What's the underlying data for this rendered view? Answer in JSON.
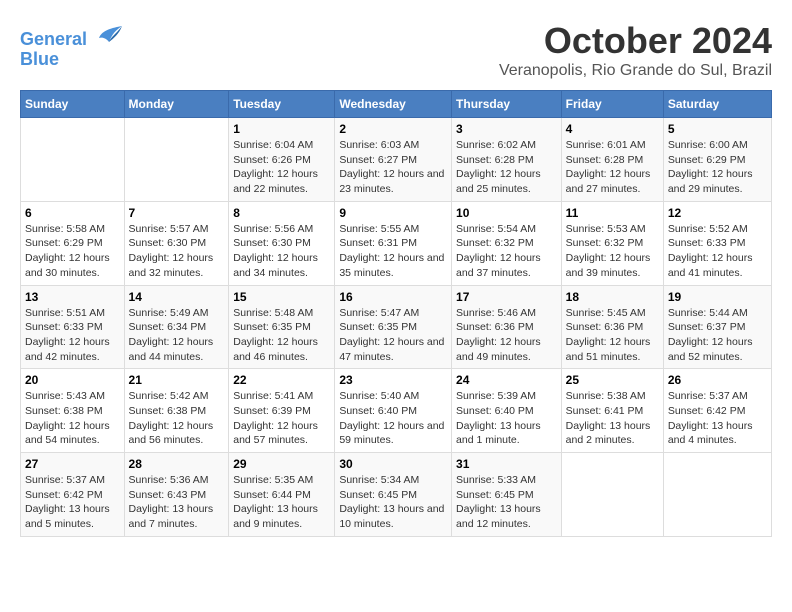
{
  "header": {
    "logo_line1": "General",
    "logo_line2": "Blue",
    "month": "October 2024",
    "location": "Veranopolis, Rio Grande do Sul, Brazil"
  },
  "weekdays": [
    "Sunday",
    "Monday",
    "Tuesday",
    "Wednesday",
    "Thursday",
    "Friday",
    "Saturday"
  ],
  "weeks": [
    [
      {
        "day": null,
        "sunrise": null,
        "sunset": null,
        "daylight": null
      },
      {
        "day": null,
        "sunrise": null,
        "sunset": null,
        "daylight": null
      },
      {
        "day": "1",
        "sunrise": "Sunrise: 6:04 AM",
        "sunset": "Sunset: 6:26 PM",
        "daylight": "Daylight: 12 hours and 22 minutes."
      },
      {
        "day": "2",
        "sunrise": "Sunrise: 6:03 AM",
        "sunset": "Sunset: 6:27 PM",
        "daylight": "Daylight: 12 hours and 23 minutes."
      },
      {
        "day": "3",
        "sunrise": "Sunrise: 6:02 AM",
        "sunset": "Sunset: 6:28 PM",
        "daylight": "Daylight: 12 hours and 25 minutes."
      },
      {
        "day": "4",
        "sunrise": "Sunrise: 6:01 AM",
        "sunset": "Sunset: 6:28 PM",
        "daylight": "Daylight: 12 hours and 27 minutes."
      },
      {
        "day": "5",
        "sunrise": "Sunrise: 6:00 AM",
        "sunset": "Sunset: 6:29 PM",
        "daylight": "Daylight: 12 hours and 29 minutes."
      }
    ],
    [
      {
        "day": "6",
        "sunrise": "Sunrise: 5:58 AM",
        "sunset": "Sunset: 6:29 PM",
        "daylight": "Daylight: 12 hours and 30 minutes."
      },
      {
        "day": "7",
        "sunrise": "Sunrise: 5:57 AM",
        "sunset": "Sunset: 6:30 PM",
        "daylight": "Daylight: 12 hours and 32 minutes."
      },
      {
        "day": "8",
        "sunrise": "Sunrise: 5:56 AM",
        "sunset": "Sunset: 6:30 PM",
        "daylight": "Daylight: 12 hours and 34 minutes."
      },
      {
        "day": "9",
        "sunrise": "Sunrise: 5:55 AM",
        "sunset": "Sunset: 6:31 PM",
        "daylight": "Daylight: 12 hours and 35 minutes."
      },
      {
        "day": "10",
        "sunrise": "Sunrise: 5:54 AM",
        "sunset": "Sunset: 6:32 PM",
        "daylight": "Daylight: 12 hours and 37 minutes."
      },
      {
        "day": "11",
        "sunrise": "Sunrise: 5:53 AM",
        "sunset": "Sunset: 6:32 PM",
        "daylight": "Daylight: 12 hours and 39 minutes."
      },
      {
        "day": "12",
        "sunrise": "Sunrise: 5:52 AM",
        "sunset": "Sunset: 6:33 PM",
        "daylight": "Daylight: 12 hours and 41 minutes."
      }
    ],
    [
      {
        "day": "13",
        "sunrise": "Sunrise: 5:51 AM",
        "sunset": "Sunset: 6:33 PM",
        "daylight": "Daylight: 12 hours and 42 minutes."
      },
      {
        "day": "14",
        "sunrise": "Sunrise: 5:49 AM",
        "sunset": "Sunset: 6:34 PM",
        "daylight": "Daylight: 12 hours and 44 minutes."
      },
      {
        "day": "15",
        "sunrise": "Sunrise: 5:48 AM",
        "sunset": "Sunset: 6:35 PM",
        "daylight": "Daylight: 12 hours and 46 minutes."
      },
      {
        "day": "16",
        "sunrise": "Sunrise: 5:47 AM",
        "sunset": "Sunset: 6:35 PM",
        "daylight": "Daylight: 12 hours and 47 minutes."
      },
      {
        "day": "17",
        "sunrise": "Sunrise: 5:46 AM",
        "sunset": "Sunset: 6:36 PM",
        "daylight": "Daylight: 12 hours and 49 minutes."
      },
      {
        "day": "18",
        "sunrise": "Sunrise: 5:45 AM",
        "sunset": "Sunset: 6:36 PM",
        "daylight": "Daylight: 12 hours and 51 minutes."
      },
      {
        "day": "19",
        "sunrise": "Sunrise: 5:44 AM",
        "sunset": "Sunset: 6:37 PM",
        "daylight": "Daylight: 12 hours and 52 minutes."
      }
    ],
    [
      {
        "day": "20",
        "sunrise": "Sunrise: 5:43 AM",
        "sunset": "Sunset: 6:38 PM",
        "daylight": "Daylight: 12 hours and 54 minutes."
      },
      {
        "day": "21",
        "sunrise": "Sunrise: 5:42 AM",
        "sunset": "Sunset: 6:38 PM",
        "daylight": "Daylight: 12 hours and 56 minutes."
      },
      {
        "day": "22",
        "sunrise": "Sunrise: 5:41 AM",
        "sunset": "Sunset: 6:39 PM",
        "daylight": "Daylight: 12 hours and 57 minutes."
      },
      {
        "day": "23",
        "sunrise": "Sunrise: 5:40 AM",
        "sunset": "Sunset: 6:40 PM",
        "daylight": "Daylight: 12 hours and 59 minutes."
      },
      {
        "day": "24",
        "sunrise": "Sunrise: 5:39 AM",
        "sunset": "Sunset: 6:40 PM",
        "daylight": "Daylight: 13 hours and 1 minute."
      },
      {
        "day": "25",
        "sunrise": "Sunrise: 5:38 AM",
        "sunset": "Sunset: 6:41 PM",
        "daylight": "Daylight: 13 hours and 2 minutes."
      },
      {
        "day": "26",
        "sunrise": "Sunrise: 5:37 AM",
        "sunset": "Sunset: 6:42 PM",
        "daylight": "Daylight: 13 hours and 4 minutes."
      }
    ],
    [
      {
        "day": "27",
        "sunrise": "Sunrise: 5:37 AM",
        "sunset": "Sunset: 6:42 PM",
        "daylight": "Daylight: 13 hours and 5 minutes."
      },
      {
        "day": "28",
        "sunrise": "Sunrise: 5:36 AM",
        "sunset": "Sunset: 6:43 PM",
        "daylight": "Daylight: 13 hours and 7 minutes."
      },
      {
        "day": "29",
        "sunrise": "Sunrise: 5:35 AM",
        "sunset": "Sunset: 6:44 PM",
        "daylight": "Daylight: 13 hours and 9 minutes."
      },
      {
        "day": "30",
        "sunrise": "Sunrise: 5:34 AM",
        "sunset": "Sunset: 6:45 PM",
        "daylight": "Daylight: 13 hours and 10 minutes."
      },
      {
        "day": "31",
        "sunrise": "Sunrise: 5:33 AM",
        "sunset": "Sunset: 6:45 PM",
        "daylight": "Daylight: 13 hours and 12 minutes."
      },
      {
        "day": null,
        "sunrise": null,
        "sunset": null,
        "daylight": null
      },
      {
        "day": null,
        "sunrise": null,
        "sunset": null,
        "daylight": null
      }
    ]
  ]
}
